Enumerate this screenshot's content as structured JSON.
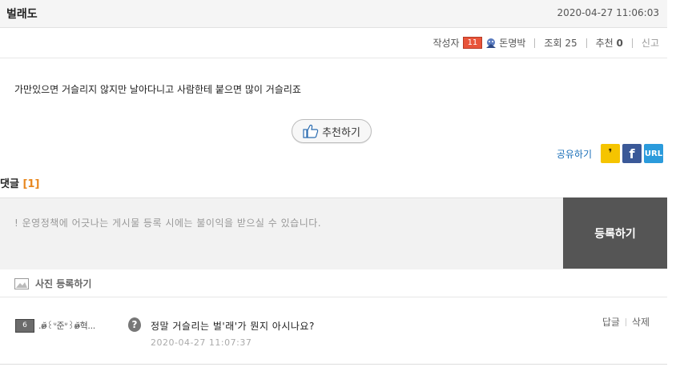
{
  "post": {
    "title": "벌래도",
    "datetime": "2020-04-27 11:06:03",
    "author_label": "작성자",
    "author_level": "11",
    "author_name": "돈명박",
    "views_label": "조회",
    "views": "25",
    "recommend_label": "추천",
    "recommend": "0",
    "report_label": "신고",
    "content": "가만있으면 거슬리지 않지만 날아다니고 사람한테 붙으면 많이 거슬리죠",
    "recommend_button": "추천하기"
  },
  "share": {
    "label": "공유하기",
    "icons": [
      "kakaostory-icon",
      "facebook-icon",
      "url-icon"
    ],
    "kakao_glyph": "❜",
    "fb_glyph": "f",
    "url_glyph": "URL"
  },
  "comments": {
    "title": "댓글",
    "count": "[1]",
    "placeholder": "! 운영정책에 어긋나는 게시물 등록 시에는 불이익을 받으실 수 있습니다.",
    "submit_label": "등록하기",
    "photo_label": "사진 등록하기",
    "items": [
      {
        "level": "6",
        "nickname": ".ʚ̴̶̷̆꒰ᐡ준ᐡ꒱ʚ̴̶̷̆혁...",
        "question_glyph": "?",
        "text": "정말 거슬리는 벌'래'가 뭔지 아시나요?",
        "time": "2020-04-27 11:07:37",
        "reply_label": "답글",
        "delete_label": "삭제"
      }
    ]
  },
  "colors": {
    "level_badge": "#e8543a",
    "comment_count": "#e8871e",
    "share_label": "#1a6fb8",
    "submit_bg": "#555555"
  }
}
